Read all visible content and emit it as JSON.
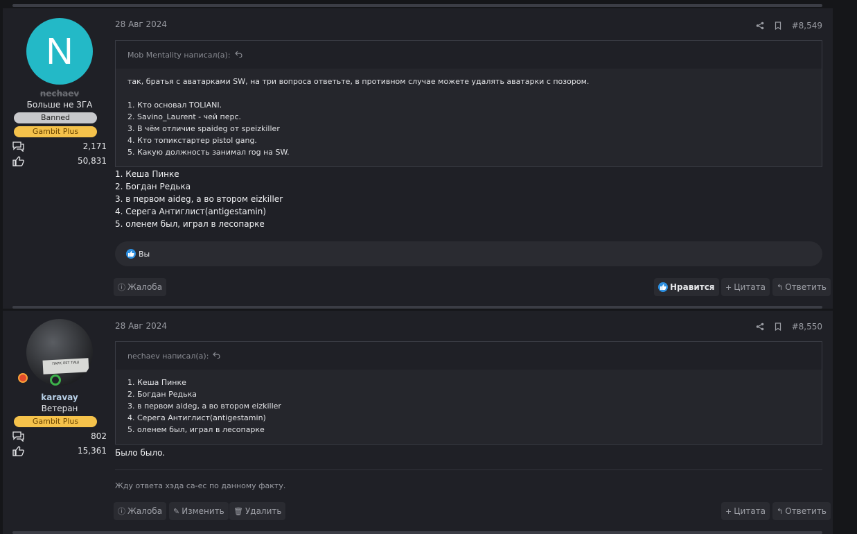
{
  "posts": [
    {
      "author": "nechaev",
      "avatar_letter": "N",
      "user_title": "Больше не ЗГА",
      "badges": [
        "Banned",
        "Gambit Plus"
      ],
      "messages_count": "2,171",
      "reactions_count": "50,831",
      "date": "28 Авг 2024",
      "post_number": "#8,549",
      "quote": {
        "header": "Mob Mentality написал(а):",
        "intro": "так, братья с аватарками SW, на три вопроса ответьте, в противном случае можете удалять аватарки с позором.",
        "lines": [
          "1. Кто основал TOLIANI.",
          "2. Savino_Laurent - чей перс.",
          "3. В чём отличие spaideg от speizkiller",
          "4. Кто топикстартер pistol gang.",
          "5. Какую должность занимал rog на SW."
        ]
      },
      "message_lines": [
        "1. Кеша Пинке",
        "2. Богдан Редька",
        "3. в первом aideg, а во втором eizkiller",
        "4. Серега Антиглист(antigestamin)",
        "5. оленем был, играл в лесопарке"
      ],
      "reaction_text": "Вы",
      "actions": {
        "report": "Жалоба",
        "like": "Нравится",
        "quote": "Цитата",
        "reply": "Ответить"
      }
    },
    {
      "author": "karavay",
      "user_title": "Ветеран",
      "badges": [
        "Gambit Plus"
      ],
      "messages_count": "802",
      "reactions_count": "15,361",
      "date": "28 Авг 2024",
      "post_number": "#8,550",
      "avatar_sign": "ПАРК ЛЕТ ТИШ",
      "quote": {
        "header": "nechaev написал(а):",
        "lines": [
          "1. Кеша Пинке",
          "2. Богдан Редька",
          "3. в первом aideg, а во втором eizkiller",
          "4. Серега Антиглист(antigestamin)",
          "5. оленем был, играл в лесопарке"
        ]
      },
      "message": "Было было.",
      "signature": "Жду ответа хэда са-ес по данному факту.",
      "actions": {
        "report": "Жалоба",
        "edit": "Изменить",
        "delete": "Удалить",
        "quote": "Цитата",
        "reply": "Ответить"
      }
    }
  ],
  "colors": {
    "page_bg": "#151619",
    "post_bg": "#1f2026",
    "accent_teal": "#23b9c7",
    "gambit_gold": "#f5c24b",
    "like_blue": "#2d8fe0"
  }
}
